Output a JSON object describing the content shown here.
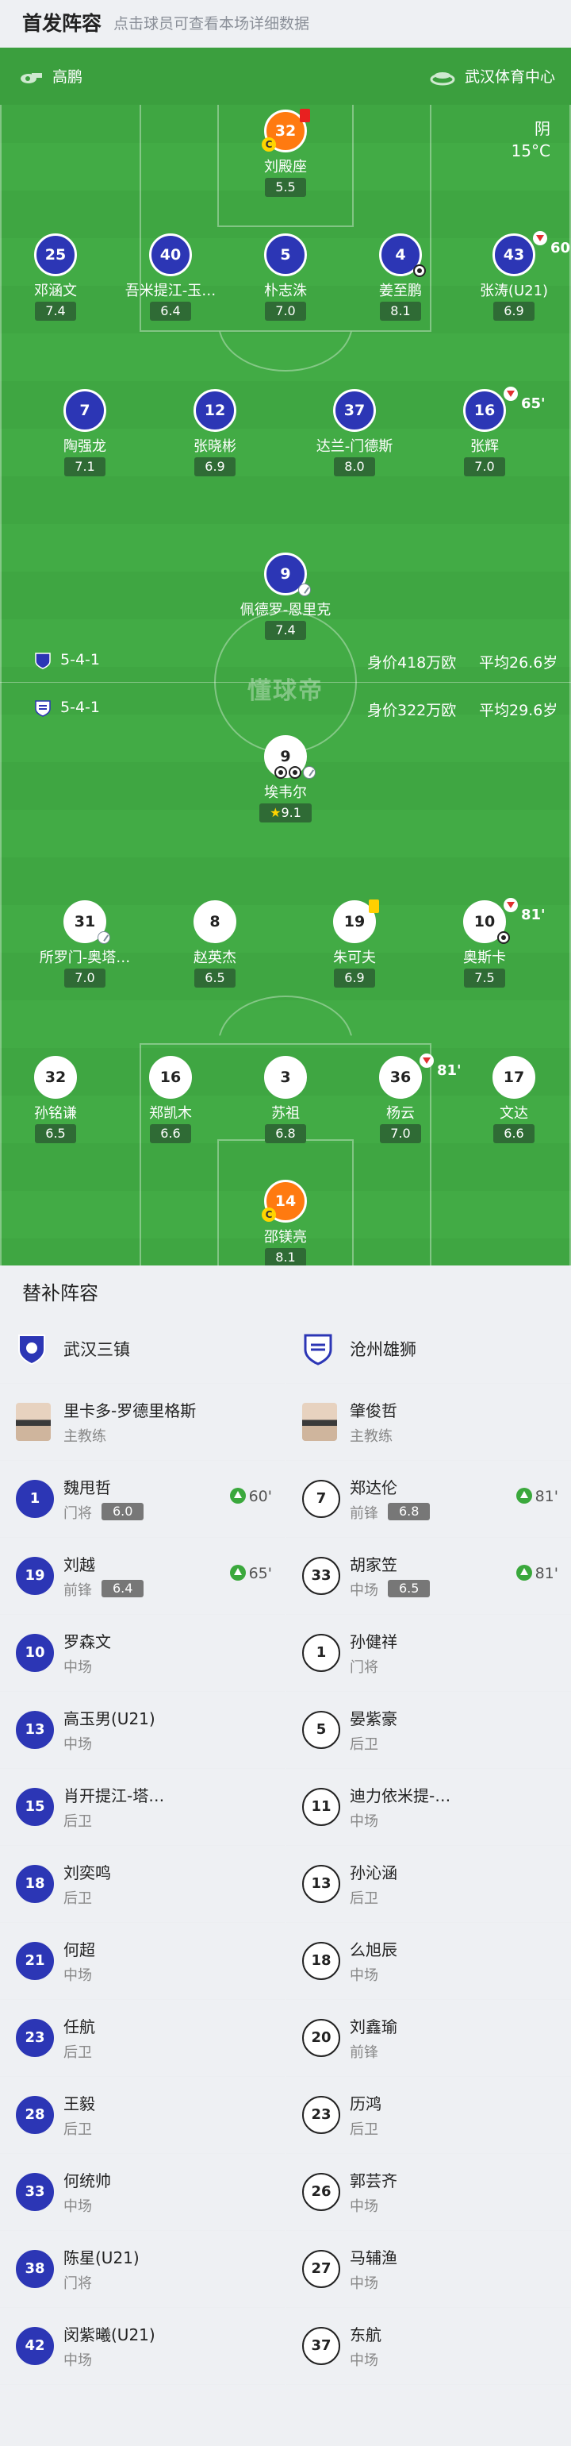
{
  "header": {
    "title": "首发阵容",
    "hint": "点击球员可查看本场详细数据"
  },
  "info": {
    "referee": "高鹏",
    "venue": "武汉体育中心",
    "weather": "阴",
    "temperature": "15°C"
  },
  "watermark": "懂球帝",
  "teams": {
    "home": {
      "formation": "5-4-1",
      "value": "身价418万欧",
      "age": "平均26.6岁"
    },
    "away": {
      "formation": "5-4-1",
      "value": "身价322万欧",
      "age": "平均29.6岁"
    }
  },
  "home_lineup": [
    {
      "number": "32",
      "name": "刘殿座",
      "rating": "5.5"
    },
    {
      "number": "25",
      "name": "邓涵文",
      "rating": "7.4"
    },
    {
      "number": "40",
      "name": "吾米提江-玉…",
      "rating": "6.4"
    },
    {
      "number": "5",
      "name": "朴志洙",
      "rating": "7.0"
    },
    {
      "number": "4",
      "name": "姜至鹏",
      "rating": "8.1"
    },
    {
      "number": "43",
      "name": "张涛(U21)",
      "rating": "6.9",
      "sub": "60'"
    },
    {
      "number": "7",
      "name": "陶强龙",
      "rating": "7.1"
    },
    {
      "number": "12",
      "name": "张晓彬",
      "rating": "6.9"
    },
    {
      "number": "37",
      "name": "达兰-门德斯",
      "rating": "8.0"
    },
    {
      "number": "16",
      "name": "张辉",
      "rating": "7.0",
      "sub": "65'"
    },
    {
      "number": "9",
      "name": "佩德罗-恩里克",
      "rating": "7.4"
    }
  ],
  "away_lineup": [
    {
      "number": "9",
      "name": "埃韦尔",
      "rating": "9.1"
    },
    {
      "number": "31",
      "name": "所罗门-奥塔…",
      "rating": "7.0"
    },
    {
      "number": "8",
      "name": "赵英杰",
      "rating": "6.5"
    },
    {
      "number": "19",
      "name": "朱可夫",
      "rating": "6.9"
    },
    {
      "number": "10",
      "name": "奥斯卡",
      "rating": "7.5",
      "sub": "81'"
    },
    {
      "number": "32",
      "name": "孙铭谦",
      "rating": "6.5"
    },
    {
      "number": "16",
      "name": "郑凯木",
      "rating": "6.6"
    },
    {
      "number": "3",
      "name": "苏祖",
      "rating": "6.8"
    },
    {
      "number": "36",
      "name": "杨云",
      "rating": "7.0",
      "sub": "81'"
    },
    {
      "number": "17",
      "name": "文达",
      "rating": "6.6"
    },
    {
      "number": "14",
      "name": "邵镁亮",
      "rating": "8.1"
    }
  ],
  "subs_title": "替补阵容",
  "home_team": {
    "name": "武汉三镇",
    "coach": {
      "name": "里卡多-罗德里格斯",
      "role": "主教练"
    },
    "subs": [
      {
        "number": "1",
        "name": "魏甩哲",
        "pos": "门将",
        "rating": "6.0",
        "in": "60'"
      },
      {
        "number": "19",
        "name": "刘越",
        "pos": "前锋",
        "rating": "6.4",
        "in": "65'"
      },
      {
        "number": "10",
        "name": "罗森文",
        "pos": "中场"
      },
      {
        "number": "13",
        "name": "高玉男(U21)",
        "pos": "中场"
      },
      {
        "number": "15",
        "name": "肖开提江-塔…",
        "pos": "后卫"
      },
      {
        "number": "18",
        "name": "刘奕鸣",
        "pos": "后卫"
      },
      {
        "number": "21",
        "name": "何超",
        "pos": "中场"
      },
      {
        "number": "23",
        "name": "任航",
        "pos": "后卫"
      },
      {
        "number": "28",
        "name": "王毅",
        "pos": "后卫"
      },
      {
        "number": "33",
        "name": "何统帅",
        "pos": "中场"
      },
      {
        "number": "38",
        "name": "陈星(U21)",
        "pos": "门将"
      },
      {
        "number": "42",
        "name": "闵紫曦(U21)",
        "pos": "中场"
      }
    ]
  },
  "away_team": {
    "name": "沧州雄狮",
    "coach": {
      "name": "肇俊哲",
      "role": "主教练"
    },
    "subs": [
      {
        "number": "7",
        "name": "郑达伦",
        "pos": "前锋",
        "rating": "6.8",
        "in": "81'"
      },
      {
        "number": "33",
        "name": "胡家笠",
        "pos": "中场",
        "rating": "6.5",
        "in": "81'"
      },
      {
        "number": "1",
        "name": "孙健祥",
        "pos": "门将"
      },
      {
        "number": "5",
        "name": "晏紫豪",
        "pos": "后卫"
      },
      {
        "number": "11",
        "name": "迪力依米提-…",
        "pos": "中场"
      },
      {
        "number": "13",
        "name": "孙沁涵",
        "pos": "后卫"
      },
      {
        "number": "18",
        "name": "么旭辰",
        "pos": "中场"
      },
      {
        "number": "20",
        "name": "刘鑫瑜",
        "pos": "前锋"
      },
      {
        "number": "23",
        "name": "历鸿",
        "pos": "后卫"
      },
      {
        "number": "26",
        "name": "郭芸齐",
        "pos": "中场"
      },
      {
        "number": "27",
        "name": "马辅渔",
        "pos": "中场"
      },
      {
        "number": "37",
        "name": "东航",
        "pos": "中场"
      }
    ]
  },
  "colors": {
    "home": "#2c36b5",
    "keeper": "#ff7a10",
    "pitch": "#42ab45"
  }
}
